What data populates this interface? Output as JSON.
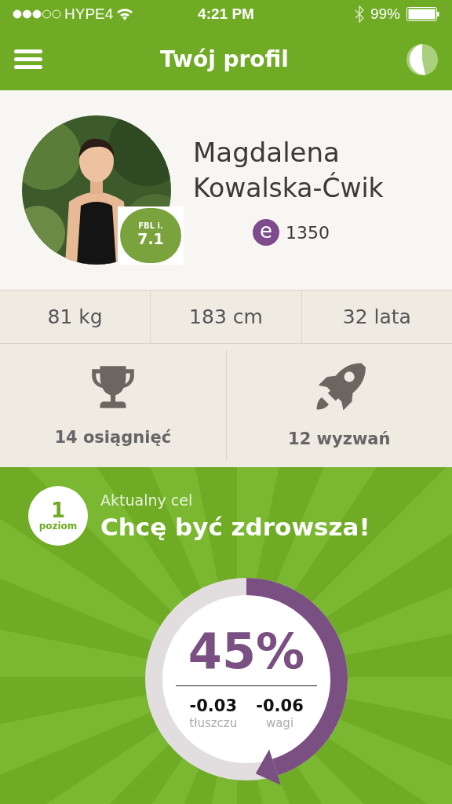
{
  "status_bar": {
    "carrier": "HYPE4",
    "time": "4:21 PM",
    "battery": "99%"
  },
  "header": {
    "title": "Twój profil"
  },
  "profile": {
    "first_name": "Magdalena",
    "last_name": "Kowalska-Ćwik",
    "badge": {
      "label": "FBL i.",
      "value": "7.1"
    },
    "points": {
      "icon_letter": "e",
      "value": "1350"
    }
  },
  "stats": [
    "81 kg",
    "183 cm",
    "32 lata"
  ],
  "achievements": [
    {
      "kind": "trophy",
      "label": "14 osiągnięć"
    },
    {
      "kind": "rocket",
      "label": "12 wyzwań"
    }
  ],
  "goal": {
    "level_number": "1",
    "level_label": "poziom",
    "caption": "Aktualny cel",
    "title": "Chcę być zdrowsza!",
    "progress": {
      "percent": "45%",
      "metrics": [
        {
          "value": "-0.03",
          "label": "tłuszczu"
        },
        {
          "value": "-0.06",
          "label": "wagi"
        }
      ]
    }
  }
}
